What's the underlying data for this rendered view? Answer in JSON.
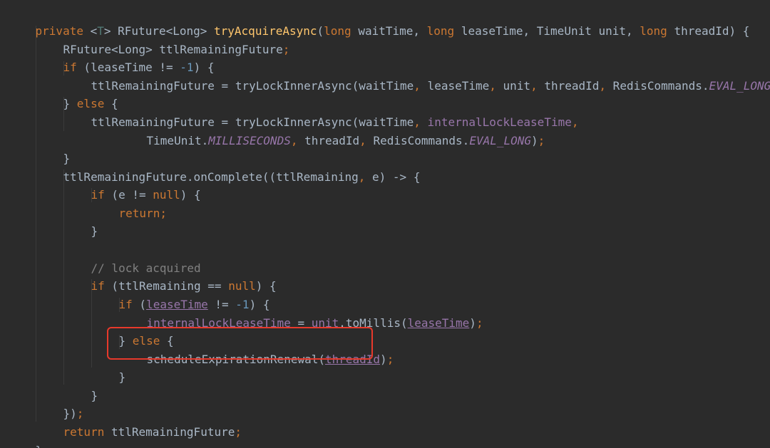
{
  "code": {
    "l1": {
      "kw_private": "private",
      "lt": "<",
      "type_param": "T",
      "gt_sp": "> RFuture<Long> ",
      "method_name": "tryAcquireAsync",
      "open_paren": "(",
      "kw_long1": "long",
      "p1": " waitTime, ",
      "kw_long2": "long",
      "p2": " leaseTime, TimeUnit unit, ",
      "kw_long3": "long",
      "p3": " threadId) {"
    },
    "l2": {
      "text": "RFuture<Long> ttlRemainingFuture",
      "semi": ";"
    },
    "l3": {
      "kw_if": "if",
      "a": " (leaseTime != ",
      "num": "-1",
      "b": ") {"
    },
    "l4": {
      "a": "ttlRemainingFuture = tryLockInnerAsync(waitTime",
      "c1": ",",
      "b": " leaseTime",
      "c2": ",",
      "c": " unit",
      "c3": ",",
      "d": " threadId",
      "c4": ",",
      "e": " RedisCommands.",
      "const": "EVAL_LONG",
      "f": ")",
      "semi": ";"
    },
    "l5": {
      "a": "} ",
      "kw_else": "else",
      "b": " {"
    },
    "l6": {
      "a": "ttlRemainingFuture = tryLockInnerAsync(waitTime",
      "c1": ",",
      "field": " internalLockLeaseTime",
      "c2": ","
    },
    "l7": {
      "a": "TimeUnit.",
      "const1": "MILLISECONDS",
      "c1": ",",
      "b": " threadId",
      "c2": ",",
      "c": " RedisCommands.",
      "const2": "EVAL_LONG",
      "d": ")",
      "semi": ";"
    },
    "l8": {
      "text": "}"
    },
    "l9": {
      "a": "ttlRemainingFuture.onComplete((ttlRemaining",
      "c1": ",",
      "b": " e) -> {"
    },
    "l10": {
      "kw_if": "if",
      "a": " (e != ",
      "kw_null": "null",
      "b": ") {"
    },
    "l11": {
      "kw_return": "return",
      "semi": ";"
    },
    "l12": {
      "text": "}"
    },
    "l13": {
      "comment": "// lock acquired"
    },
    "l14": {
      "kw_if": "if",
      "a": " (ttlRemaining == ",
      "kw_null": "null",
      "b": ") {"
    },
    "l15": {
      "kw_if": "if",
      "a": " (",
      "var": "leaseTime",
      "b": " != ",
      "num": "-1",
      "c": ") {"
    },
    "l16": {
      "field": "internalLockLeaseTime",
      "a": " = ",
      "var": "unit",
      "b": ".toMillis(",
      "var2": "leaseTime",
      "c": ")",
      "semi": ";"
    },
    "l17": {
      "a": "} ",
      "kw_else": "else",
      "b": " {"
    },
    "l18": {
      "a": "scheduleExpirationRenewal(",
      "var": "threadId",
      "b": ")",
      "semi": ";"
    },
    "l19": {
      "text": "}"
    },
    "l20": {
      "text": "}"
    },
    "l21": {
      "a": "})",
      "semi": ";"
    },
    "l22": {
      "kw_return": "return",
      "a": " ttlRemainingFuture",
      "semi": ";"
    },
    "l23": {
      "text": "}"
    }
  },
  "colors": {
    "background": "#2b2b2b",
    "keyword": "#cc7832",
    "method_declaration": "#ffc66d",
    "number": "#6897bb",
    "field": "#9876aa",
    "comment": "#808080",
    "highlight_box": "#e8392b"
  }
}
